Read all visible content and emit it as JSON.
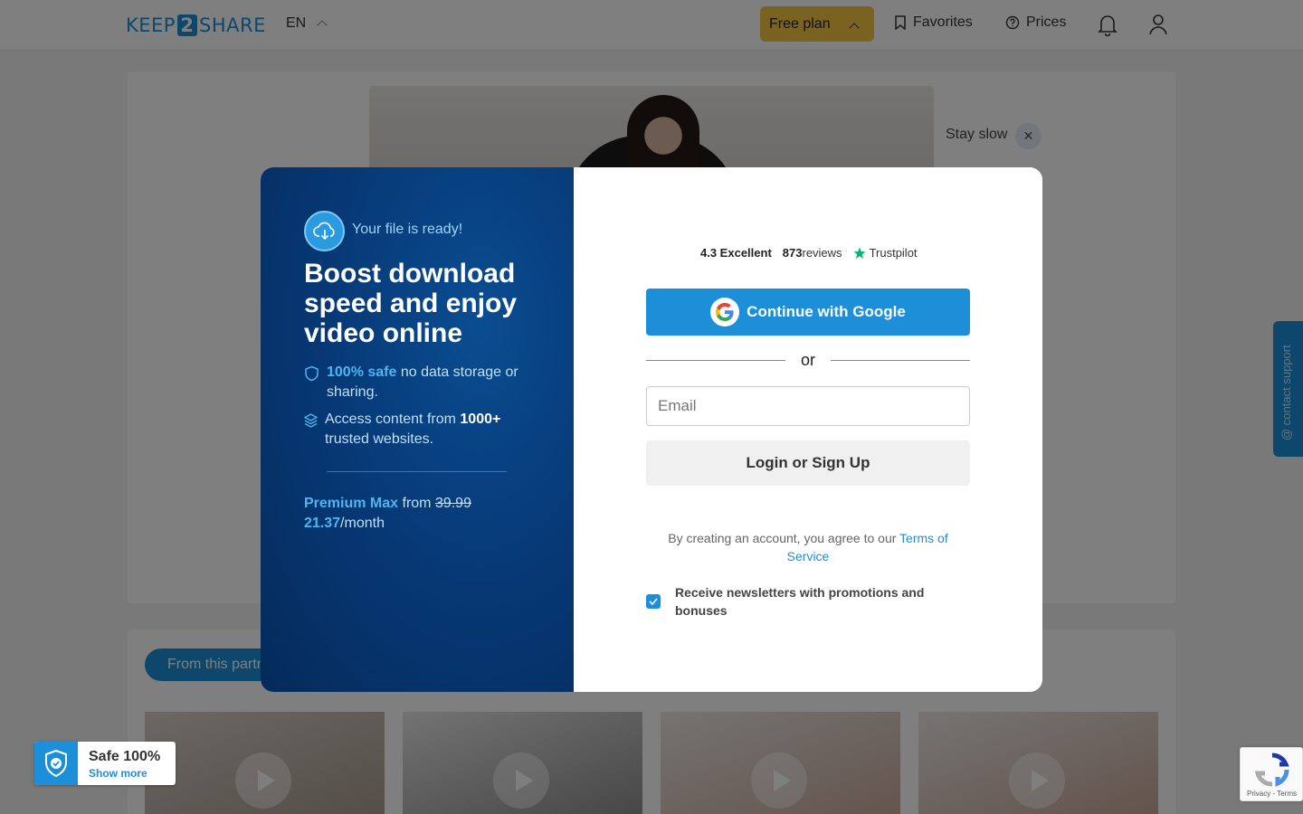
{
  "header": {
    "logo_left": "KEEP",
    "logo_num": "2",
    "logo_right": "SHARE",
    "language": "EN",
    "plan_label": "Free plan",
    "favorites_label": "Favorites",
    "prices_label": "Prices"
  },
  "content": {
    "stay_slow_label": "Stay slow",
    "partner_tab_label": "From this partner"
  },
  "support": {
    "label": "@ contact support"
  },
  "modal": {
    "left": {
      "ready_text": "Your file is ready!",
      "headline": "Boost download speed and enjoy video online",
      "feature1_strong": "100% safe",
      "feature1_rest": " no data storage or sharing.",
      "feature2_pre": "Access content from ",
      "feature2_strong": "1000+",
      "feature2_rest": " trusted websites.",
      "premium_name": "Premium Max",
      "premium_from": " from ",
      "premium_old_price": "39.99",
      "premium_new_price": "21.37",
      "premium_period": "/month"
    },
    "right": {
      "trust_score": "4.3 Excellent",
      "trust_count": "873",
      "trust_reviews": "reviews",
      "trust_brand": "Trustpilot",
      "google_label": "Continue with Google",
      "or_label": "or",
      "email_placeholder": "Email",
      "login_label": "Login or Sign Up",
      "terms_pre": "By creating an account, you agree to our ",
      "terms_link": "Terms of Service",
      "newsletter_label": "Receive newsletters with promotions and bonuses"
    }
  },
  "safe_badge": {
    "title": "Safe 100%",
    "link": "Show more"
  },
  "recaptcha": {
    "privacy": "Privacy",
    "terms": "Terms"
  },
  "colors": {
    "brand_blue": "#1d8fd8",
    "plan_yellow": "#f5c542",
    "modal_navy": "#073a78"
  }
}
